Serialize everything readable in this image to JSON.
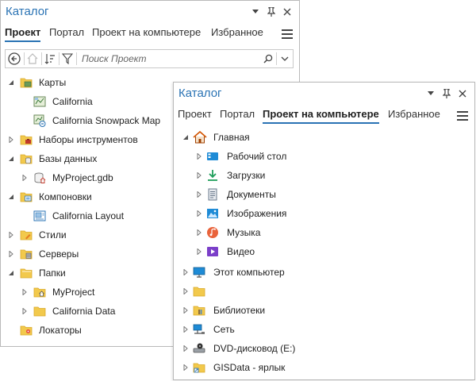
{
  "back_window": {
    "title": "Каталог",
    "tabs": [
      "Проект",
      "Портал",
      "Проект на компьютере",
      "Избранное"
    ],
    "search": {
      "placeholder": "Поиск Проект"
    },
    "tree": [
      {
        "label": "Карты",
        "icon": "maps-folder-icon",
        "level": 0,
        "expanded": true
      },
      {
        "label": "California",
        "icon": "map-icon",
        "level": 1
      },
      {
        "label": "California Snowpack Map",
        "icon": "map-link-icon",
        "level": 1
      },
      {
        "label": "Наборы инструментов",
        "icon": "toolbox-folder-icon",
        "level": 0,
        "expanded": false
      },
      {
        "label": "Базы данных",
        "icon": "database-folder-icon",
        "level": 0,
        "expanded": true
      },
      {
        "label": "MyProject.gdb",
        "icon": "geodatabase-home-icon",
        "level": 1,
        "expandable": true
      },
      {
        "label": "Компоновки",
        "icon": "layouts-folder-icon",
        "level": 0,
        "expanded": true
      },
      {
        "label": "California Layout",
        "icon": "layout-icon",
        "level": 1
      },
      {
        "label": "Стили",
        "icon": "styles-folder-icon",
        "level": 0,
        "expanded": false
      },
      {
        "label": "Серверы",
        "icon": "servers-folder-icon",
        "level": 0,
        "expanded": false
      },
      {
        "label": "Папки",
        "icon": "folders-icon",
        "level": 0,
        "expanded": true
      },
      {
        "label": "MyProject",
        "icon": "home-folder-icon",
        "level": 1,
        "expandable": true
      },
      {
        "label": "California Data",
        "icon": "folder-icon",
        "level": 1,
        "expandable": true
      },
      {
        "label": "Локаторы",
        "icon": "locators-folder-icon",
        "level": 0
      }
    ]
  },
  "front_window": {
    "title": "Каталог",
    "tabs": [
      "Проект",
      "Портал",
      "Проект на компьютере",
      "Избранное"
    ],
    "tree": [
      {
        "label": "Главная",
        "icon": "home-icon",
        "level": 0,
        "expanded": true
      },
      {
        "label": "Рабочий стол",
        "icon": "desktop-icon",
        "level": 1
      },
      {
        "label": "Загрузки",
        "icon": "downloads-icon",
        "level": 1
      },
      {
        "label": "Документы",
        "icon": "documents-icon",
        "level": 1
      },
      {
        "label": "Изображения",
        "icon": "pictures-icon",
        "level": 1
      },
      {
        "label": "Музыка",
        "icon": "music-icon",
        "level": 1
      },
      {
        "label": "Видео",
        "icon": "videos-icon",
        "level": 1
      },
      {
        "label": "Этот компьютер",
        "icon": "computer-icon",
        "level": 0
      },
      {
        "label": "",
        "icon": "folder-icon",
        "level": 0
      },
      {
        "label": "Библиотеки",
        "icon": "libraries-icon",
        "level": 0
      },
      {
        "label": "Сеть",
        "icon": "network-icon",
        "level": 0
      },
      {
        "label": "DVD-дисковод (E:)",
        "icon": "dvd-drive-icon",
        "level": 0
      },
      {
        "label": "GISData - ярлык",
        "icon": "folder-shortcut-icon",
        "level": 0
      }
    ]
  },
  "colors": {
    "accent": "#2a73b4",
    "folder": "#f2c94c"
  }
}
